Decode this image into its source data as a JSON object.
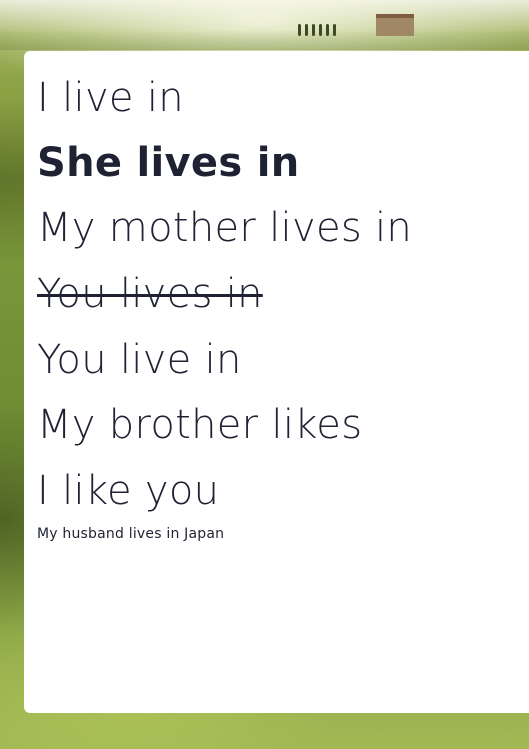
{
  "lines": [
    {
      "text": "I live in",
      "style": "normal"
    },
    {
      "text": "She lives in",
      "style": "bold"
    },
    {
      "text": "My mother lives in",
      "style": "normal"
    },
    {
      "text": "You lives in",
      "style": "strikethrough"
    },
    {
      "text": "You live in",
      "style": "normal"
    },
    {
      "text": "My brother likes",
      "style": "normal"
    },
    {
      "text": "I like you",
      "style": "normal"
    }
  ],
  "caption": "My husband lives in Japan",
  "colors": {
    "text": "#1f2233",
    "card": "#ffffff",
    "background": "#8aa24a"
  },
  "background_image": "tuscan-countryside-landscape"
}
